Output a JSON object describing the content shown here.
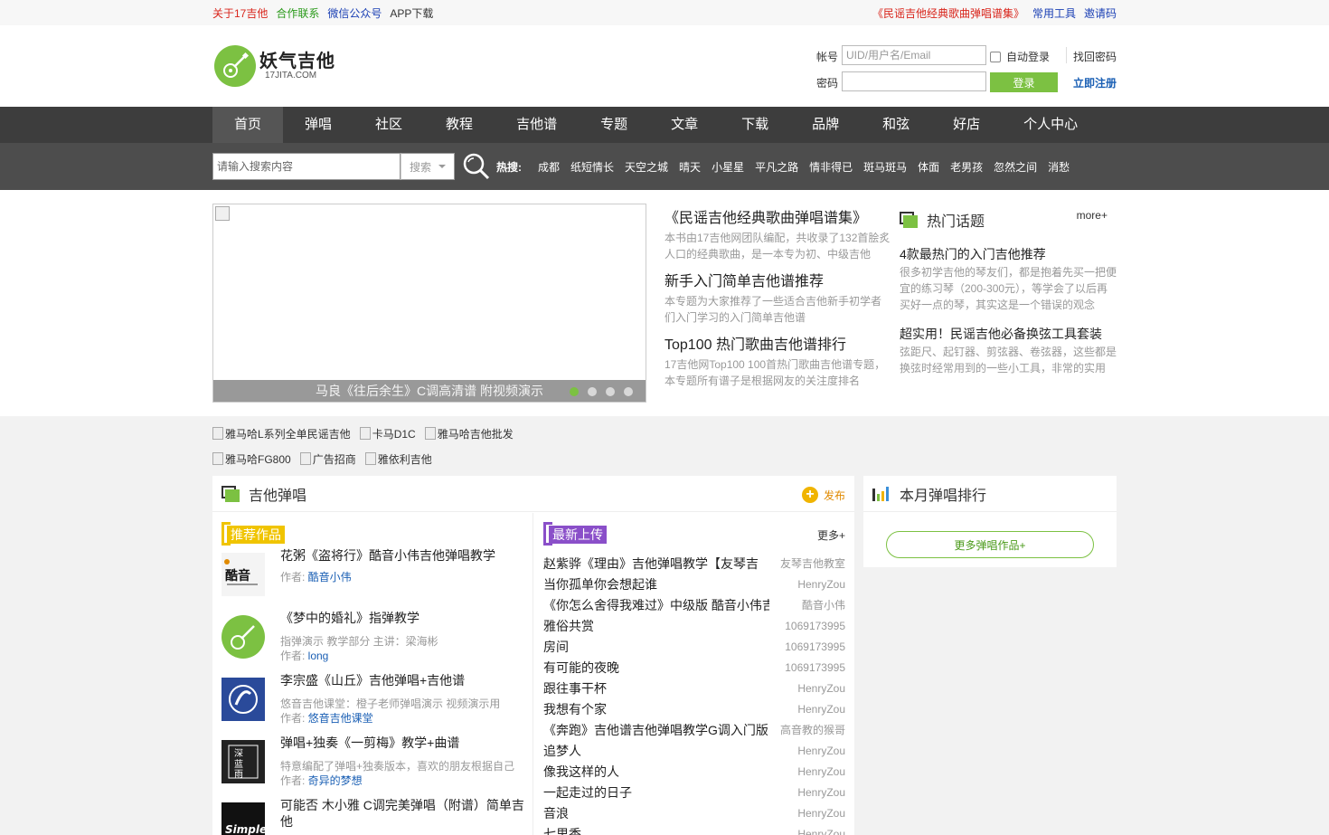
{
  "topbar": {
    "links_left": [
      {
        "label": "关于17吉他",
        "color": "#d9261c"
      },
      {
        "label": "合作联系",
        "color": "#2a9a1a"
      },
      {
        "label": "微信公众号",
        "color": "#1a3fb4"
      },
      {
        "label": "APP下载",
        "color": "#333333"
      }
    ],
    "links_right": [
      {
        "label": "《民谣吉他经典歌曲弹唱谱集》",
        "color": "#d9261c"
      },
      {
        "label": "常用工具",
        "color": "#1a3fb4"
      },
      {
        "label": "邀请码",
        "color": "#1a3fb4"
      }
    ]
  },
  "logo": {
    "name_cn": "妖气吉他",
    "name_en": "17JITA.COM"
  },
  "login": {
    "account_label": "帐号",
    "account_placeholder": "UID/用户名/Email",
    "password_label": "密码",
    "auto_login": "自动登录",
    "forgot": "找回密码",
    "login_button": "登录",
    "register": "立即注册"
  },
  "nav": [
    "首页",
    "弹唱",
    "社区",
    "教程",
    "吉他谱",
    "专题",
    "文章",
    "下载",
    "品牌",
    "和弦",
    "好店",
    "个人中心"
  ],
  "search": {
    "placeholder": "请输入搜索内容",
    "select": "搜索",
    "hot_label": "热搜:",
    "hot_items": [
      "成都",
      "纸短情长",
      "天空之城",
      "晴天",
      "小星星",
      "平凡之路",
      "情非得已",
      "斑马斑马",
      "体面",
      "老男孩",
      "忽然之间",
      "消愁"
    ]
  },
  "slider": {
    "caption": "马良《往后余生》C调高清谱 附视频演示",
    "dots": 4,
    "active": 0
  },
  "features": [
    {
      "title": "《民谣吉他经典歌曲弹唱谱集》",
      "desc": "本书由17吉他网团队编配，共收录了132首脍炙人口的经典歌曲，是一本专为初、中级吉他"
    },
    {
      "title": "新手入门简单吉他谱推荐",
      "desc": "本专题为大家推荐了一些适合吉他新手初学者们入门学习的入门简单吉他谱"
    },
    {
      "title": "Top100 热门歌曲吉他谱排行",
      "desc": "17吉他网Top100 100首热门歌曲吉他谱专题，本专题所有谱子是根据网友的关注度排名"
    }
  ],
  "topics": {
    "title": "热门话题",
    "more": "more+",
    "items": [
      {
        "title": "4款最热门的入门吉他推荐",
        "desc": "很多初学吉他的琴友们，都是抱着先买一把便宜的练习琴（200-300元），等学会了以后再买好一点的琴，其实这是一个错误的观念"
      },
      {
        "title": "超实用！民谣吉他必备换弦工具套装",
        "desc": "弦距尺、起钉器、剪弦器、卷弦器，这些都是换弦时经常用到的一些小工具，非常的实用"
      }
    ]
  },
  "ads": [
    [
      "雅马哈L系列全单民谣吉他",
      "卡马D1C",
      "雅马哈吉他批发"
    ],
    [
      "雅马哈FG800",
      "广告招商",
      "雅依利吉他"
    ]
  ],
  "main": {
    "title": "吉他弹唱",
    "publish": "发布",
    "recommended_label": "推荐作品",
    "latest_label": "最新上传",
    "more": "更多+",
    "author_prefix": "作者: ",
    "recommended": [
      {
        "title": "花粥《盗将行》酷音小伟吉他弹唱教学",
        "desc": "",
        "author": "酷音小伟",
        "thumb": "kuyin"
      },
      {
        "title": "《梦中的婚礼》指弹教学",
        "desc": "指弹演示 教学部分 主讲：梁海彬",
        "author": "long",
        "thumb": "guitar"
      },
      {
        "title": "李宗盛《山丘》吉他弹唱+吉他谱",
        "desc": "悠音吉他课堂：橙子老师弹唱演示 视频演示用",
        "author": "悠音吉他课堂",
        "thumb": "youyin"
      },
      {
        "title": "弹唱+独奏《一剪梅》教学+曲谱",
        "desc": "特意编配了弹唱+独奏版本，喜欢的朋友根据自己",
        "author": "奇异的梦想",
        "thumb": "shenlan"
      },
      {
        "title": "可能否 木小雅 C调完美弹唱（附谱）简单吉他",
        "desc": "",
        "author": "",
        "thumb": "simple"
      }
    ],
    "latest": [
      {
        "title": "赵紫骅《理由》吉他弹唱教学【友琴吉",
        "author": "友琴吉他教室"
      },
      {
        "title": "当你孤单你会想起谁",
        "author": "HenryZou"
      },
      {
        "title": "《你怎么舍得我难过》中级版 酷音小伟吉他",
        "author": "酷音小伟"
      },
      {
        "title": "雅俗共赏",
        "author": "1069173995"
      },
      {
        "title": "房间",
        "author": "1069173995"
      },
      {
        "title": "有可能的夜晚",
        "author": "1069173995"
      },
      {
        "title": "跟往事干杯",
        "author": "HenryZou"
      },
      {
        "title": "我想有个家",
        "author": "HenryZou"
      },
      {
        "title": "《奔跑》吉他谱吉他弹唱教学G调入门版",
        "author": "高音教的猴哥"
      },
      {
        "title": "追梦人",
        "author": "HenryZou"
      },
      {
        "title": "像我这样的人",
        "author": "HenryZou"
      },
      {
        "title": "一起走过的日子",
        "author": "HenryZou"
      },
      {
        "title": "音浪",
        "author": "HenryZou"
      },
      {
        "title": "七里香",
        "author": "HenryZou"
      }
    ]
  },
  "side": {
    "title": "本月弹唱排行",
    "more_button": "更多弹唱作品+"
  },
  "colors": {
    "brand_green": "#7cc142",
    "nav_dark": "#3d3d3d",
    "search_bar": "#4d4d4d",
    "tag_yellow": "#f0c400",
    "tag_purple": "#8a4fc9"
  }
}
